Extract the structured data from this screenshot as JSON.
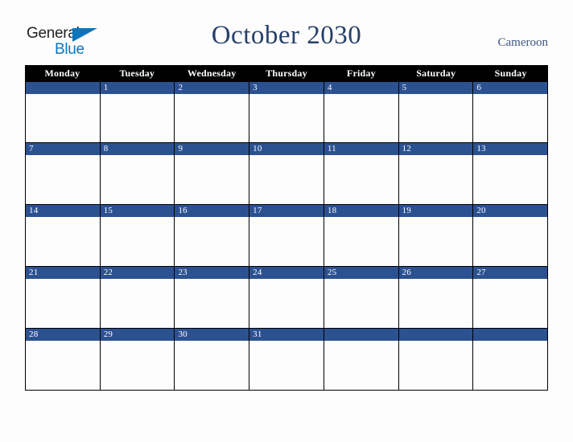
{
  "header": {
    "logo": {
      "line1": "General",
      "line2": "Blue",
      "triangle_color": "#0b76bd",
      "text_color": "#231f20"
    },
    "title": "October 2030",
    "locale": "Cameroon"
  },
  "calendar": {
    "weekdays": [
      "Monday",
      "Tuesday",
      "Wednesday",
      "Thursday",
      "Friday",
      "Saturday",
      "Sunday"
    ],
    "weekday_header_bg": "#000000",
    "weekday_header_color": "#ffffff",
    "day_band_color": "#2c5191",
    "day_number_color": "#ffffff",
    "cell_bg": "#fdfdfd",
    "grid_line_color": "#000000",
    "weeks": [
      {
        "days": [
          "",
          "1",
          "2",
          "3",
          "4",
          "5",
          "6"
        ]
      },
      {
        "days": [
          "7",
          "8",
          "9",
          "10",
          "11",
          "12",
          "13"
        ]
      },
      {
        "days": [
          "14",
          "15",
          "16",
          "17",
          "18",
          "19",
          "20"
        ]
      },
      {
        "days": [
          "21",
          "22",
          "23",
          "24",
          "25",
          "26",
          "27"
        ]
      },
      {
        "days": [
          "28",
          "29",
          "30",
          "31",
          "",
          "",
          ""
        ]
      }
    ]
  }
}
